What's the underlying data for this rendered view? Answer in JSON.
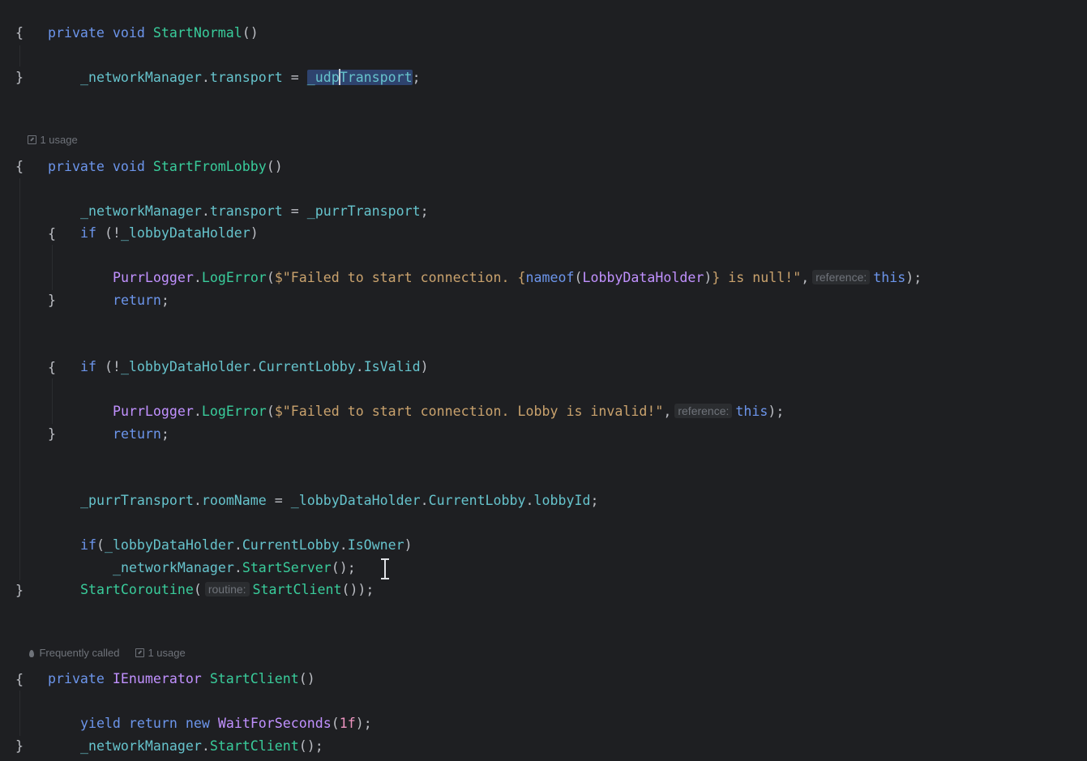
{
  "editor": {
    "lines": {
      "l01": [
        "private",
        " ",
        "void",
        " ",
        "StartNormal",
        "()"
      ],
      "l02": "{",
      "l03": [
        "_networkManager",
        ".",
        "transport",
        " = ",
        "_udp",
        "ransport",
        ";"
      ],
      "l03_caret_char": "T",
      "l04": "}",
      "lens1": "1 usage",
      "l05": [
        "private",
        " ",
        "void",
        " ",
        "StartFromLobby",
        "()"
      ],
      "l06": "{",
      "l07": [
        "_networkManager",
        ".",
        "transport",
        " = ",
        "_purrTransport",
        ";"
      ],
      "l08": [
        "if",
        " (!",
        "_lobbyDataHolder",
        ")"
      ],
      "l09": "{",
      "l10": [
        "PurrLogger",
        ".",
        "LogError",
        "(",
        "$\"Failed to start connection. {",
        "nameof",
        "(",
        "LobbyDataHolder",
        ")",
        "} is null!\"",
        ",",
        "reference:",
        "this",
        ");"
      ],
      "l11": [
        "return",
        ";"
      ],
      "l12": "}",
      "l13": [
        "if",
        " (!",
        "_lobbyDataHolder",
        ".",
        "CurrentLobby",
        ".",
        "IsValid",
        ")"
      ],
      "l14": "{",
      "l15": [
        "PurrLogger",
        ".",
        "LogError",
        "(",
        "$\"Failed to start connection. Lobby is invalid!\"",
        ",",
        "reference:",
        "this",
        ");"
      ],
      "l16": [
        "return",
        ";"
      ],
      "l17": "}",
      "l18": [
        "_purrTransport",
        ".",
        "roomName",
        " = ",
        "_lobbyDataHolder",
        ".",
        "CurrentLobby",
        ".",
        "lobbyId",
        ";"
      ],
      "l19": [
        "if",
        "(",
        "_lobbyDataHolder",
        ".",
        "CurrentLobby",
        ".",
        "IsOwner",
        ")"
      ],
      "l20": [
        "_networkManager",
        ".",
        "StartServer",
        "();"
      ],
      "l21": [
        "StartCoroutine",
        "(",
        "routine:",
        "StartClient",
        "());"
      ],
      "l22": "}",
      "lens2a": "Frequently called",
      "lens2b": "1 usage",
      "l23": [
        "private",
        " ",
        "IEnumerator",
        " ",
        "StartClient",
        "()"
      ],
      "l24": "{",
      "l25": [
        "yield",
        " ",
        "return",
        " ",
        "new",
        " ",
        "WaitForSeconds",
        "(",
        "1f",
        ");"
      ],
      "l26": [
        "_networkManager",
        ".",
        "StartClient",
        "();"
      ],
      "l27": "}"
    }
  },
  "theme": {
    "background": "#1e1f22",
    "keyword": "#6c95eb",
    "method": "#39cc9b",
    "type": "#c191ff",
    "field": "#66c3cc",
    "string": "#c9a26d",
    "number": "#ed94c0",
    "hint": "#6f737a",
    "selection": "#2e436e"
  },
  "icons": [
    "usages-icon",
    "flame-icon",
    "text-cursor-icon"
  ]
}
